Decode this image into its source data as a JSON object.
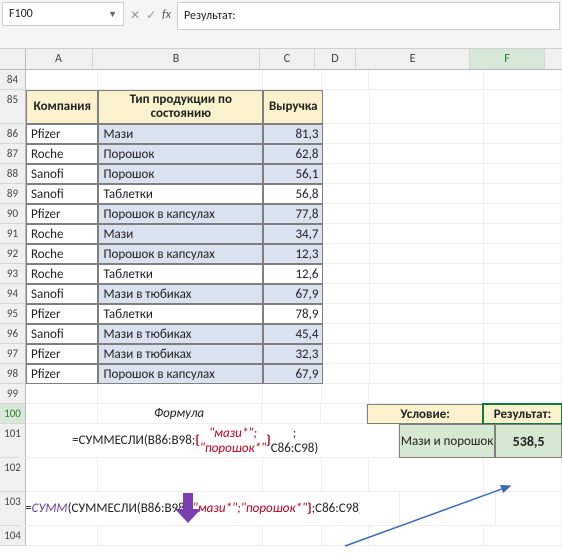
{
  "namebox": "F100",
  "fx_label": "fx",
  "formula_bar": "Результат:",
  "cols": {
    "A": "A",
    "B": "B",
    "C": "C",
    "D": "D",
    "E": "E",
    "F": "F"
  },
  "rownums": [
    "84",
    "85",
    "86",
    "87",
    "88",
    "89",
    "90",
    "91",
    "92",
    "93",
    "94",
    "95",
    "96",
    "97",
    "98",
    "99",
    "100",
    "101",
    "102",
    "103",
    "104"
  ],
  "headers": {
    "company": "Компания",
    "type": "Тип продукции по состоянию",
    "revenue": "Выручка"
  },
  "table": [
    {
      "c": "Pfizer",
      "t": "Мази",
      "v": "81,3",
      "hi": true
    },
    {
      "c": "Roche",
      "t": "Порошок",
      "v": "62,8",
      "hi": true
    },
    {
      "c": "Sanofi",
      "t": "Порошок",
      "v": "56,1",
      "hi": true
    },
    {
      "c": "Sanofi",
      "t": "Таблетки",
      "v": "56,8",
      "hi": false
    },
    {
      "c": "Pfizer",
      "t": "Порошок в капсулах",
      "v": "77,8",
      "hi": true
    },
    {
      "c": "Roche",
      "t": "Мази",
      "v": "34,7",
      "hi": true
    },
    {
      "c": "Roche",
      "t": "Порошок в капсулах",
      "v": "12,3",
      "hi": true
    },
    {
      "c": "Roche",
      "t": "Таблетки",
      "v": "12,6",
      "hi": false
    },
    {
      "c": "Sanofi",
      "t": "Мази в тюбиках",
      "v": "67,9",
      "hi": true
    },
    {
      "c": "Pfizer",
      "t": "Таблетки",
      "v": "78,9",
      "hi": false
    },
    {
      "c": "Sanofi",
      "t": "Мази в тюбиках",
      "v": "45,4",
      "hi": true
    },
    {
      "c": "Pfizer",
      "t": "Мази в тюбиках",
      "v": "32,3",
      "hi": true
    },
    {
      "c": "Pfizer",
      "t": "Порошок в капсулах",
      "v": "67,9",
      "hi": true
    }
  ],
  "formula_label": "Формула",
  "formula1": {
    "pre": "=СУММЕСЛИ(B86:B98; ",
    "brace_open": "{",
    "arg": "\"мази*\"; \"порошок*\"",
    "brace_close": "}",
    "post": " ; C86:C98)"
  },
  "formula2": {
    "eq": "= ",
    "sum": "СУММ",
    "open": " (СУММЕСЛИ(B86:B98; ",
    "brace_open": "{",
    "arg": "\"мази*\";\"порошок*\"",
    "brace_close": "}",
    "post": ";C86:C98))"
  },
  "cond": {
    "label": "Условие:",
    "value": "Мази и порошок"
  },
  "result": {
    "label": "Результат:",
    "value": "538,5"
  }
}
